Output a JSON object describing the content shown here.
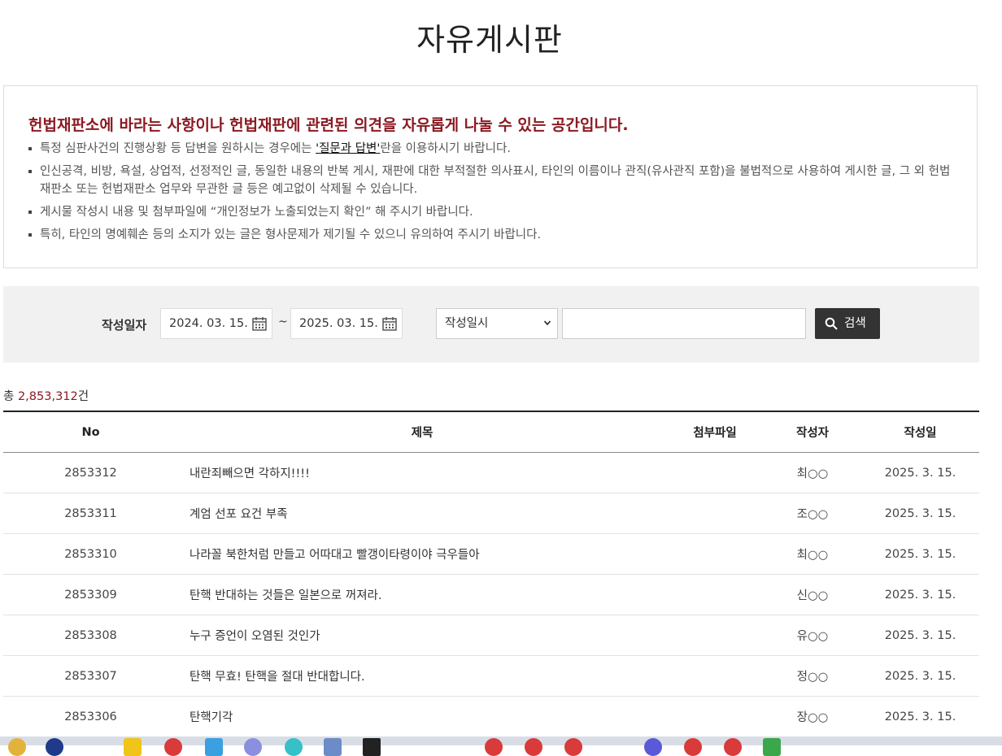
{
  "page": {
    "title": "자유게시판"
  },
  "notice": {
    "heading": "헌법재판소에 바라는 사항이나 헌법재판에 관련된 의견을 자유롭게 나눌 수 있는 공간입니다.",
    "item1_pre": "특정 심판사건의 진행상황 등 답변을 원하시는 경우에는 ",
    "item1_link": "'질문과 답변'",
    "item1_post": "란을 이용하시기 바랍니다.",
    "item2": "인신공격, 비방, 욕설, 상업적, 선정적인 글, 동일한 내용의 반복 게시, 재판에 대한 부적절한 의사표시, 타인의 이름이나 관직(유사관직 포함)을 불법적으로 사용하여 게시한 글, 그 외 헌법재판소 또는 헌법재판소 업무와 무관한 글 등은 예고없이 삭제될 수 있습니다.",
    "item3": "게시물 작성시 내용 및 첨부파일에 “개인정보가 노출되었는지 확인” 해 주시기 바랍니다.",
    "item4": "특히, 타인의 명예훼손 등의 소지가 있는 글은 형사문제가 제기될 수 있으니 유의하여 주시기 바랍니다."
  },
  "search": {
    "label": "작성일자",
    "date_from": "2024. 03. 15.",
    "separator": "~",
    "date_to": "2025. 03. 15.",
    "select_value": "작성일시",
    "keyword": "",
    "button_label": "검색"
  },
  "total": {
    "prefix": "총 ",
    "count": "2,853,312",
    "suffix": "건"
  },
  "table": {
    "headers": {
      "no": "No",
      "subject": "제목",
      "attachment": "첨부파일",
      "author": "작성자",
      "date": "작성일"
    },
    "rows": [
      {
        "no": "2853312",
        "subject": "내란죄빼으면 각하지!!!!",
        "attachment": "",
        "author": "최○○",
        "date": "2025. 3. 15."
      },
      {
        "no": "2853311",
        "subject": "계엄 선포 요건 부족",
        "attachment": "",
        "author": "조○○",
        "date": "2025. 3. 15."
      },
      {
        "no": "2853310",
        "subject": "나라꼴 북한처럼 만들고 어따대고 빨갱이타령이야 극우들아",
        "attachment": "",
        "author": "최○○",
        "date": "2025. 3. 15."
      },
      {
        "no": "2853309",
        "subject": "탄핵 반대하는 것들은 일본으로 꺼져라.",
        "attachment": "",
        "author": "신○○",
        "date": "2025. 3. 15."
      },
      {
        "no": "2853308",
        "subject": "누구 증언이 오염된 것인가",
        "attachment": "",
        "author": "유○○",
        "date": "2025. 3. 15."
      },
      {
        "no": "2853307",
        "subject": "탄핵 무효! 탄핵을 절대 반대합니다.",
        "attachment": "",
        "author": "정○○",
        "date": "2025. 3. 15."
      },
      {
        "no": "2853306",
        "subject": "탄핵기각",
        "attachment": "",
        "author": "장○○",
        "date": "2025. 3. 15."
      }
    ]
  },
  "colors": {
    "accent": "#8b1a22",
    "button_bg": "#333333",
    "search_bg": "#f1f1f1"
  }
}
